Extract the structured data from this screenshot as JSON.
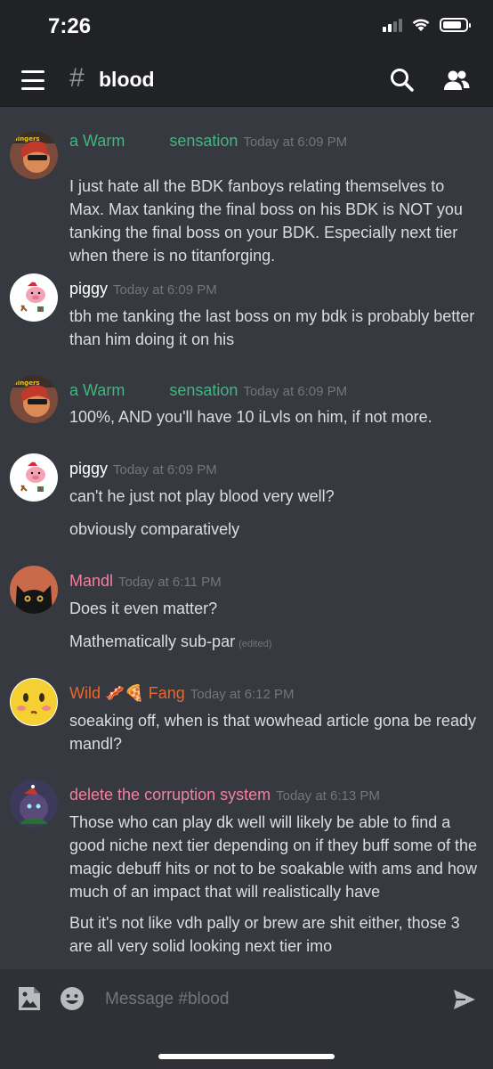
{
  "status_bar": {
    "time": "7:26"
  },
  "header": {
    "hash": "#",
    "channel": "blood",
    "icons": [
      "menu-icon",
      "search-icon",
      "members-icon"
    ]
  },
  "colors": {
    "background": "#36393f",
    "header": "#202225",
    "input_bar": "#2f3136",
    "green_role": "#43b581",
    "pink_role": "#f47fff",
    "orange_role": "#f26522",
    "timestamp": "#72767d"
  },
  "messages": [
    {
      "user_part1": "a Warm",
      "user_part2": "sensation",
      "user_color": "#43b581",
      "timestamp": "Today at 6:09 PM",
      "lines": [
        "I just hate all the BDK fanboys relating themselves to Max. Max tanking the final boss on his BDK is NOT you tanking the final boss on your BDK. Especially next tier when there is no titanforging."
      ],
      "avatar": "warm-avatar"
    },
    {
      "user": "piggy",
      "user_color": "#ffffff",
      "timestamp": "Today at 6:09 PM",
      "lines": [
        "tbh me tanking the last boss on my bdk is probably better than him doing it on his"
      ],
      "avatar": "piggy-avatar"
    },
    {
      "user_part1": "a Warm",
      "user_part2": "sensation",
      "user_color": "#43b581",
      "timestamp": "Today at 6:09 PM",
      "lines": [
        "100%, AND you'll have 10 iLvls on him, if not more."
      ],
      "avatar": "warm-avatar"
    },
    {
      "user": "piggy",
      "user_color": "#ffffff",
      "timestamp": "Today at 6:09 PM",
      "lines": [
        "can't he just not play blood very well?",
        "obviously comparatively"
      ],
      "avatar": "piggy-avatar"
    },
    {
      "user": "Mandl",
      "user_color": "#f47fa1",
      "timestamp": "Today at 6:11 PM",
      "lines": [
        "Does it even matter?",
        "Mathematically sub-par"
      ],
      "edited": "(edited)",
      "avatar": "cat-avatar"
    },
    {
      "user_part1": "Wild",
      "emoji": "🥓🍕",
      "user_part2": "Fang",
      "user_color": "#f26522",
      "timestamp": "Today at 6:12 PM",
      "lines": [
        "soeaking off, when is that wowhead article gona be ready mandl?"
      ],
      "avatar": "emoji-face-avatar"
    },
    {
      "user": "delete the corruption system",
      "user_color": "#f47fa1",
      "timestamp": "Today at 6:13 PM",
      "lines": [
        "Those who can play dk well will likely be able to find a good niche next tier depending on if they buff some of the magic debuff hits or not to be soakable with ams and how much of an impact that will realistically have",
        "But it's not like vdh pally or brew are shit either, those 3 are all very solid looking next tier imo"
      ],
      "avatar": "monster-avatar"
    }
  ],
  "input": {
    "placeholder": "Message #blood",
    "icons": [
      "image-icon",
      "emoji-icon",
      "send-icon"
    ]
  }
}
